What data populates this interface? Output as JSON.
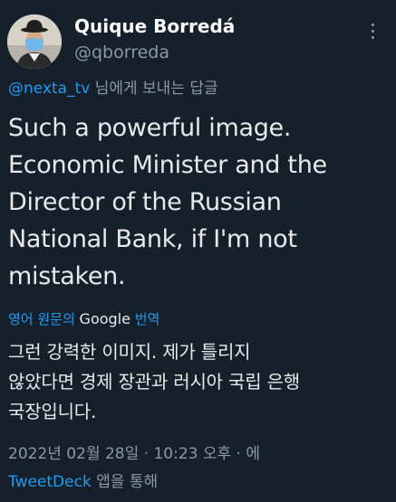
{
  "tweet": {
    "author": {
      "display_name": "Quique Borredá",
      "handle": "@qborreda",
      "avatar": "avatar-figure-bowler-hat-mask"
    },
    "more_icon": "more-dots-icon",
    "reply": {
      "mention": "@nexta_tv",
      "suffix": " 님에게 보내는 답글"
    },
    "text_lines": [
      "Such a powerful image.",
      "Economic Minister and the",
      "Director of the Russian",
      "National Bank, if I'm not",
      "mistaken."
    ],
    "translate": {
      "prefix": "영어 원문의 ",
      "google": "Google",
      "suffix": " 번역"
    },
    "translation_lines": [
      "그런 강력한 이미지. 제가 틀리지",
      "않았다면 경제 장관과 러시아 국립 은행",
      "국장입니다."
    ],
    "meta": {
      "line1": "2022년 02월 28일 · 10:23 오후 · 에",
      "app": "TweetDeck",
      "line2_suffix": " 앱을 통해"
    }
  },
  "colors": {
    "background": "#15202b",
    "text": "#e7e9ea",
    "secondary": "#8b98a5",
    "accent": "#1d9bf0"
  }
}
